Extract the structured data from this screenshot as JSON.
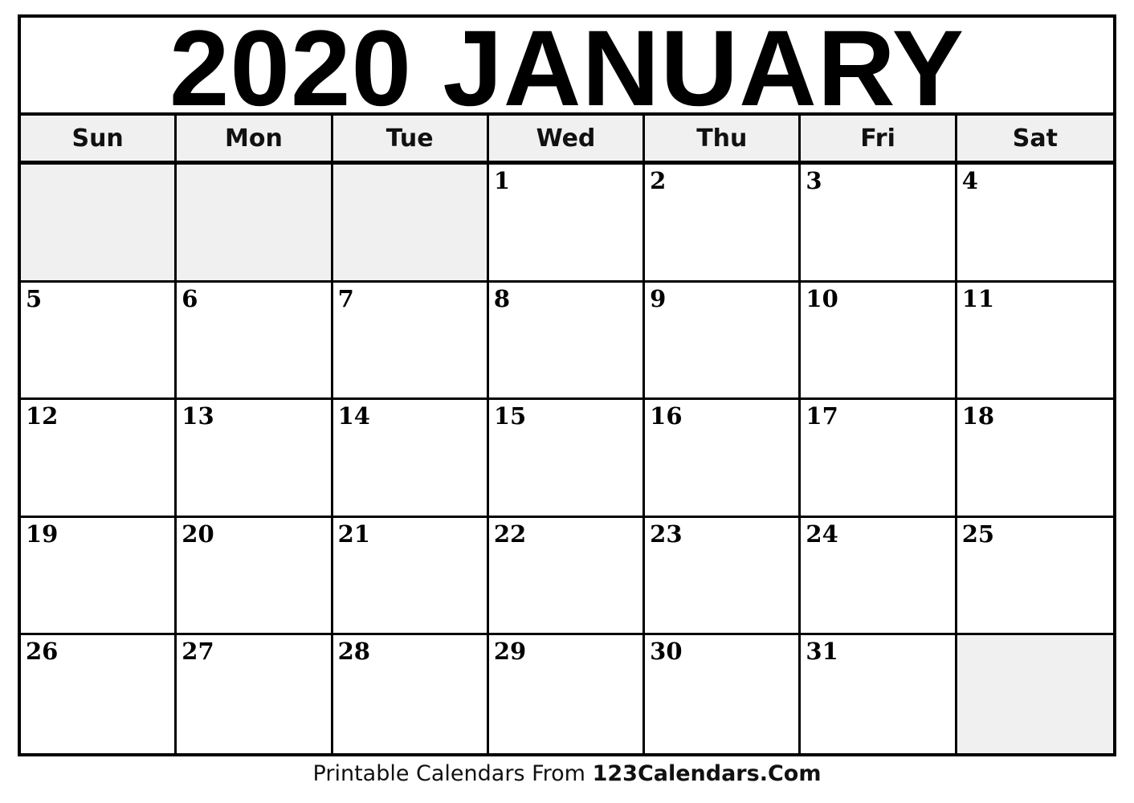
{
  "calendar": {
    "title": "2020 JANUARY",
    "year": "2020",
    "month": "JANUARY",
    "weekdays": [
      "Sun",
      "Mon",
      "Tue",
      "Wed",
      "Thu",
      "Fri",
      "Sat"
    ],
    "weeks": [
      [
        "",
        "",
        "",
        "1",
        "2",
        "3",
        "4"
      ],
      [
        "5",
        "6",
        "7",
        "8",
        "9",
        "10",
        "11"
      ],
      [
        "12",
        "13",
        "14",
        "15",
        "16",
        "17",
        "18"
      ],
      [
        "19",
        "20",
        "21",
        "22",
        "23",
        "24",
        "25"
      ],
      [
        "26",
        "27",
        "28",
        "29",
        "30",
        "31",
        ""
      ]
    ],
    "blank_color": "#f0f0f0",
    "header_color": "#f0f0f0"
  },
  "footer": {
    "prefix": "Printable Calendars From ",
    "brand": "123Calendars.Com"
  }
}
